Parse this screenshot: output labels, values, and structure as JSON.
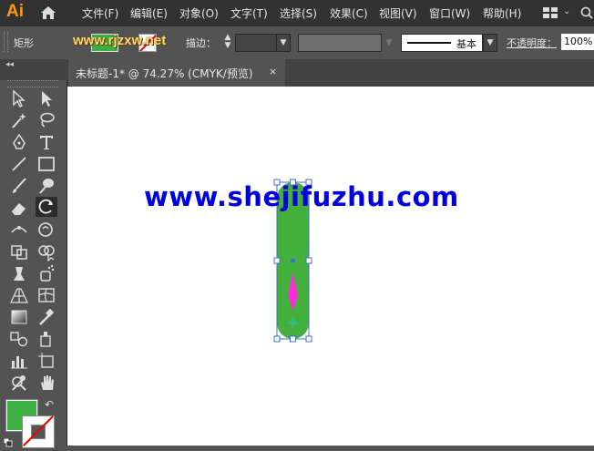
{
  "app": {
    "logo": "Ai"
  },
  "menu": [
    "文件(F)",
    "编辑(E)",
    "对象(O)",
    "文字(T)",
    "选择(S)",
    "效果(C)",
    "视图(V)",
    "窗口(W)",
    "帮助(H)"
  ],
  "control": {
    "tool_name": "矩形",
    "stroke_label": "描边：",
    "profile_label": "基本",
    "opacity_label": "不透明度：",
    "opacity_value": "100%"
  },
  "watermark_top": "www.rjzxw.net",
  "document": {
    "tab_title": "未标题-1* @ 74.27% (CMYK/预览)",
    "close": "×"
  },
  "canvas": {
    "watermark": "www.shejifuzhu.com"
  },
  "tools": [
    "selection",
    "direct-selection",
    "magic-wand",
    "lasso",
    "pen",
    "type",
    "line-segment",
    "rectangle",
    "paintbrush",
    "blob-brush",
    "eraser",
    "rotate",
    "width",
    "warp",
    "free-transform",
    "shape-builder",
    "puppet-warp",
    "symbol-sprayer",
    "perspective-grid",
    "mesh",
    "gradient",
    "eyedropper",
    "blend",
    "live-paint",
    "column-graph",
    "artboard",
    "slice",
    "hand",
    "zoom"
  ],
  "colors": {
    "fill": "#3cb043",
    "stroke": "none",
    "accent": "#ff9a00",
    "shape_fill": "#44b03c",
    "selection": "#3b6fd6",
    "rotate_arrow": "#ff2bd8",
    "watermark": "#0000dd"
  }
}
